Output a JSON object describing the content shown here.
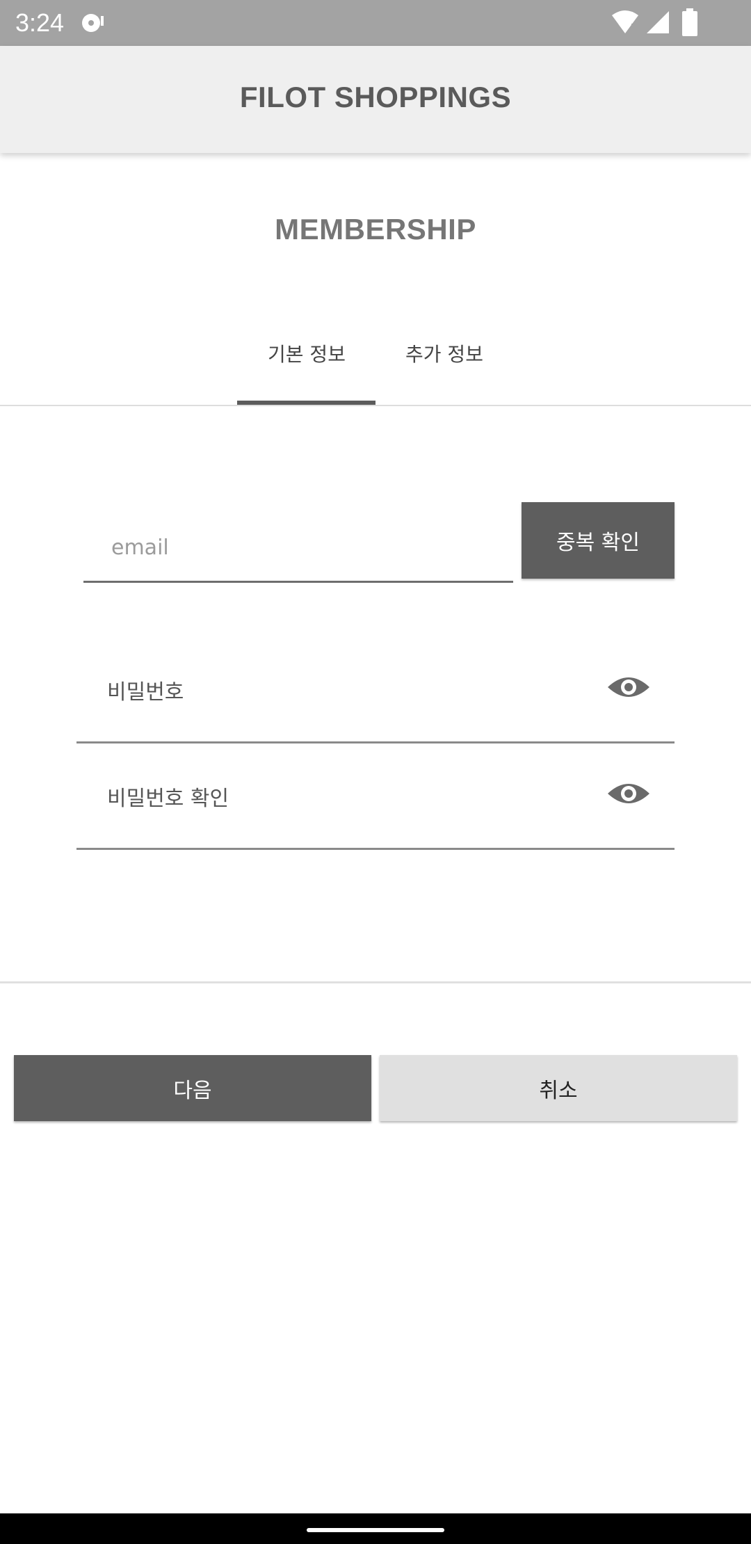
{
  "status_bar": {
    "time": "3:24",
    "icons": [
      "notification-icon",
      "wifi-icon",
      "signal-icon",
      "battery-icon"
    ]
  },
  "app_bar": {
    "title": "FILOT SHOPPINGS"
  },
  "page": {
    "title": "MEMBERSHIP"
  },
  "tabs": [
    {
      "label": "기본 정보",
      "selected": true
    },
    {
      "label": "추가 정보",
      "selected": false
    }
  ],
  "form": {
    "email": {
      "placeholder": "email",
      "value": ""
    },
    "duplicate_check_label": "중복 확인",
    "password": {
      "label": "비밀번호",
      "icon": "eye-icon"
    },
    "password_confirm": {
      "label": "비밀번호 확인",
      "icon": "eye-icon"
    }
  },
  "actions": {
    "next_label": "다음",
    "cancel_label": "취소"
  },
  "colors": {
    "status_bar": "#a3a3a3",
    "app_bar": "#efefef",
    "primary_button": "#5e5e5e",
    "secondary_button": "#e0e0e0"
  }
}
